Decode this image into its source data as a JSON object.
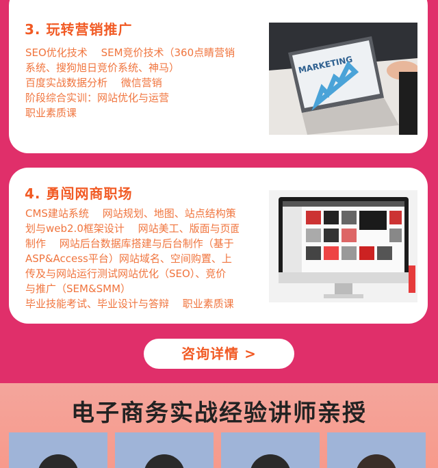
{
  "section3": {
    "title": "3. 玩转营销推广",
    "lines": [
      "SEO优化技术　 SEM竞价技术（360点睛营销",
      "系统、搜狗旭日竞价系统、神马）",
      "百度实战数据分析　 微信营销",
      "阶段综合实训：网站优化与运营",
      "职业素质课"
    ],
    "image_text": "MARKETING"
  },
  "section4": {
    "title": "4. 勇闯网商职场",
    "lines": [
      "CMS建站系统　 网站规划、地图、站点结构策",
      "划与web2.0框架设计　 网站美工、版面与页面",
      "制作　 网站后台数据库搭建与后台制作（基于",
      "ASP&Access平台）网站域名、空间购置、上",
      "传及与网站运行测试网站优化（SEO）、竞价",
      "与推广（SEM&SMM）",
      "毕业技能考试、毕业设计与答辩　 职业素质课"
    ]
  },
  "consult_button": "咨询详情 >",
  "bottom": {
    "title": "电子商务实战经验讲师亲授"
  }
}
